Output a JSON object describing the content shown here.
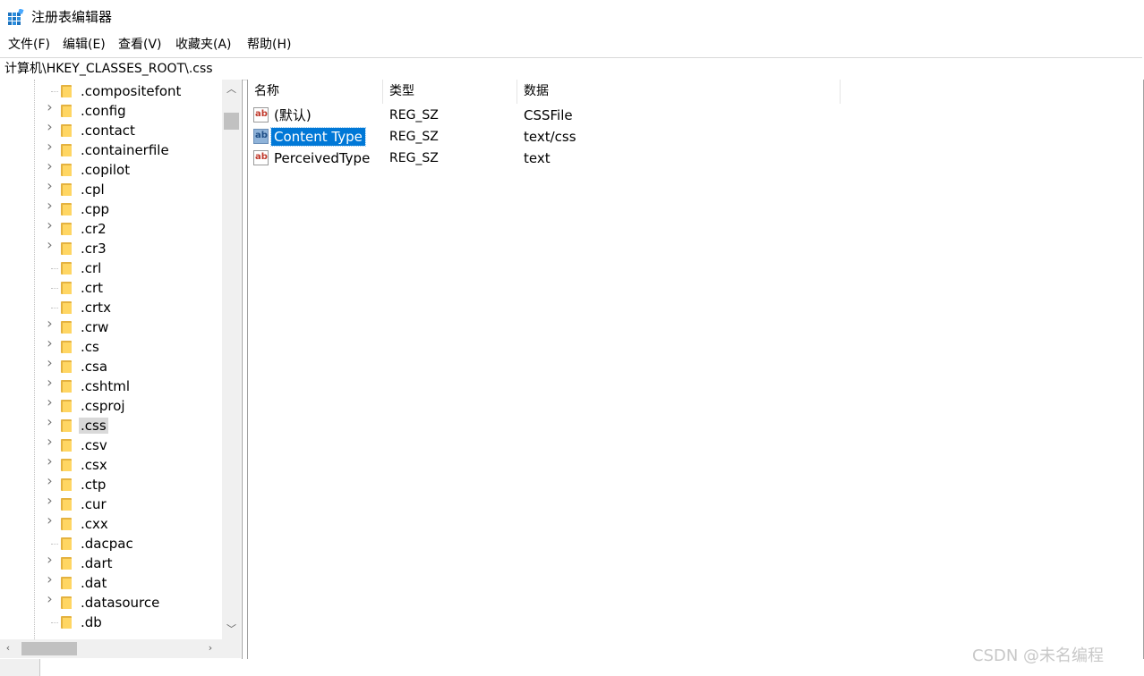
{
  "window": {
    "title": "注册表编辑器"
  },
  "menu": [
    {
      "label": "文件(F)"
    },
    {
      "label": "编辑(E)"
    },
    {
      "label": "查看(V)"
    },
    {
      "label": "收藏夹(A)"
    },
    {
      "label": "帮助(H)"
    }
  ],
  "address": {
    "path": "计算机\\HKEY_CLASSES_ROOT\\.css"
  },
  "tree": {
    "items": [
      {
        "label": ".compositefont",
        "expandable": false
      },
      {
        "label": ".config",
        "expandable": true
      },
      {
        "label": ".contact",
        "expandable": true
      },
      {
        "label": ".containerfile",
        "expandable": true
      },
      {
        "label": ".copilot",
        "expandable": true
      },
      {
        "label": ".cpl",
        "expandable": true
      },
      {
        "label": ".cpp",
        "expandable": true
      },
      {
        "label": ".cr2",
        "expandable": true
      },
      {
        "label": ".cr3",
        "expandable": true
      },
      {
        "label": ".crl",
        "expandable": false
      },
      {
        "label": ".crt",
        "expandable": false
      },
      {
        "label": ".crtx",
        "expandable": false
      },
      {
        "label": ".crw",
        "expandable": true
      },
      {
        "label": ".cs",
        "expandable": true
      },
      {
        "label": ".csa",
        "expandable": true
      },
      {
        "label": ".cshtml",
        "expandable": true
      },
      {
        "label": ".csproj",
        "expandable": true
      },
      {
        "label": ".css",
        "expandable": true,
        "selected": true
      },
      {
        "label": ".csv",
        "expandable": true
      },
      {
        "label": ".csx",
        "expandable": true
      },
      {
        "label": ".ctp",
        "expandable": true
      },
      {
        "label": ".cur",
        "expandable": true
      },
      {
        "label": ".cxx",
        "expandable": true
      },
      {
        "label": ".dacpac",
        "expandable": false
      },
      {
        "label": ".dart",
        "expandable": true
      },
      {
        "label": ".dat",
        "expandable": true
      },
      {
        "label": ".datasource",
        "expandable": true
      },
      {
        "label": ".db",
        "expandable": false
      }
    ]
  },
  "list": {
    "columns": {
      "name": "名称",
      "type": "类型",
      "data": "数据"
    },
    "rows": [
      {
        "name": "(默认)",
        "type": "REG_SZ",
        "data": "CSSFile",
        "selected": false
      },
      {
        "name": "Content Type",
        "type": "REG_SZ",
        "data": "text/css",
        "selected": true
      },
      {
        "name": "PerceivedType",
        "type": "REG_SZ",
        "data": "text",
        "selected": false
      }
    ],
    "icon_text": "ab"
  },
  "watermark": "CSDN @未名编程",
  "colors": {
    "selection": "#0078d7",
    "tree_selection": "#d9d9d9",
    "folder": "#ffd663"
  }
}
